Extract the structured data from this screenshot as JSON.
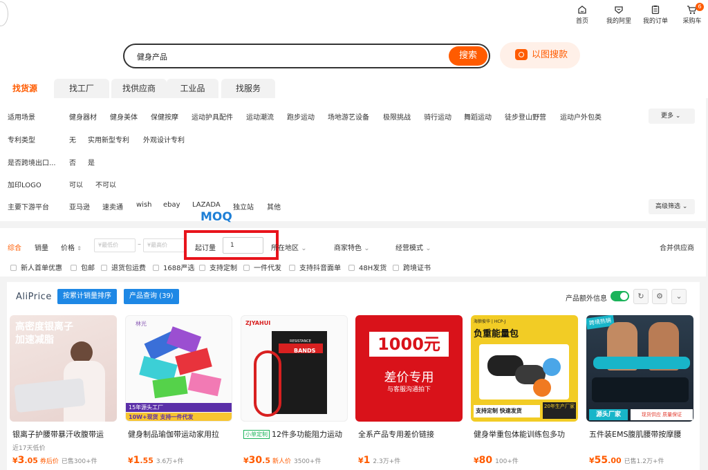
{
  "topnav": {
    "items": [
      {
        "label": "首页",
        "icon": "home-icon"
      },
      {
        "label": "我的阿里",
        "icon": "user-heart-icon"
      },
      {
        "label": "我的订单",
        "icon": "order-list-icon"
      },
      {
        "label": "采购车",
        "icon": "cart-icon",
        "badge": "6"
      }
    ]
  },
  "search": {
    "query": "健身产品",
    "button": "搜索",
    "image_search": "以图搜款"
  },
  "tabs": [
    "找货源",
    "找工厂",
    "找供应商",
    "工业品",
    "找服务"
  ],
  "filters": {
    "rows": [
      {
        "label": "适用场景",
        "options": [
          "健身器材",
          "健身美体",
          "保健按摩",
          "运动护具配件",
          "运动潮流",
          "跑步运动",
          "场地游艺设备",
          "极限挑战",
          "骑行运动",
          "舞蹈运动",
          "徒步登山野营",
          "运动户外包类"
        ]
      },
      {
        "label": "专利类型",
        "options": [
          "无",
          "实用新型专利",
          "外观设计专利"
        ]
      },
      {
        "label": "是否跨境出口...",
        "options": [
          "否",
          "是"
        ]
      },
      {
        "label": "加印LOGO",
        "options": [
          "可以",
          "不可以"
        ]
      },
      {
        "label": "主要下游平台",
        "options": [
          "亚马逊",
          "速卖通",
          "wish",
          "ebay",
          "LAZADA",
          "独立站",
          "其他"
        ]
      }
    ],
    "more": "更多",
    "advanced": "高级筛选"
  },
  "sortbar": {
    "items": [
      "综合",
      "销量",
      "价格"
    ],
    "price_min_placeholder": "¥最低价",
    "price_max_placeholder": "¥最高价",
    "dash": "–",
    "moq_annotation": "MOQ",
    "moq_label": "起订量",
    "moq_value": "1",
    "dropdowns": [
      "所在地区",
      "商家特色",
      "经营模式"
    ],
    "merge": "合并供应商",
    "checkboxes": [
      "新人首单优惠",
      "包邮",
      "退货包运费",
      "1688严选",
      "支持定制",
      "一件代发",
      "支持抖音面单",
      "48H发货",
      "跨境证书"
    ]
  },
  "aliprice": {
    "logo": "AliPrice",
    "sort_button": "按累计销量排序",
    "query_button": "产品查询 (39)",
    "extra_label": "产品额外信息"
  },
  "products": [
    {
      "title": "银离子护腰带暴汗收腹带运",
      "sub": "近17天低价",
      "price_int": "3",
      "price_dec": ".05",
      "tag": "券后价",
      "sold": "已售300+件",
      "img_text1": "高密度银离子",
      "img_text2": "加速减脂",
      "brand": ""
    },
    {
      "title": "健身制品瑜伽带运动家用拉",
      "sub": "",
      "price_int": "1",
      "price_dec": ".55",
      "tag": "",
      "sold": "3.6万+件",
      "img_text1": "15年源头工厂",
      "img_text2": "10W+现货  支持一件代发",
      "brand": "林光"
    },
    {
      "title": "12件多功能阻力运动",
      "sub": "",
      "price_int": "30",
      "price_dec": ".5",
      "tag": "新人价",
      "sold": "3500+件",
      "img_text1": "RESISTANCE",
      "img_text2": "BANDS",
      "brand": "ZJYAHUI",
      "mini_tag": "小单定制"
    },
    {
      "title": "全系产品专用差价链接",
      "sub": "",
      "price_int": "1",
      "price_dec": "",
      "tag": "",
      "sold": "2.3万+件",
      "img_text1": "1000元",
      "img_text2": "差价专用",
      "img_text3": "与客服沟通拍下",
      "brand": ""
    },
    {
      "title": "健身举重包体能训练包多功",
      "sub": "",
      "price_int": "80",
      "price_dec": "",
      "tag": "",
      "sold": "100+件",
      "img_text1": "负重能量包",
      "img_text2": "支持定制  快速发货",
      "img_text3": "20年生产厂家",
      "brand": "海狼俊华 | HCP-J"
    },
    {
      "title": "五件装EMS腹肌腰带按摩腰",
      "sub": "",
      "price_int": "55",
      "price_dec": ".00",
      "tag": "",
      "sold": "已售1.2万+件",
      "img_text1": "跨境热销",
      "img_text2": "源头厂家",
      "img_text3": "现货供应 质量保证",
      "brand": ""
    }
  ],
  "colors": {
    "accent": "#ff5b00",
    "blue": "#1e88e5",
    "annot_red": "#e8141c",
    "annot_blue": "#1e7fd6"
  }
}
